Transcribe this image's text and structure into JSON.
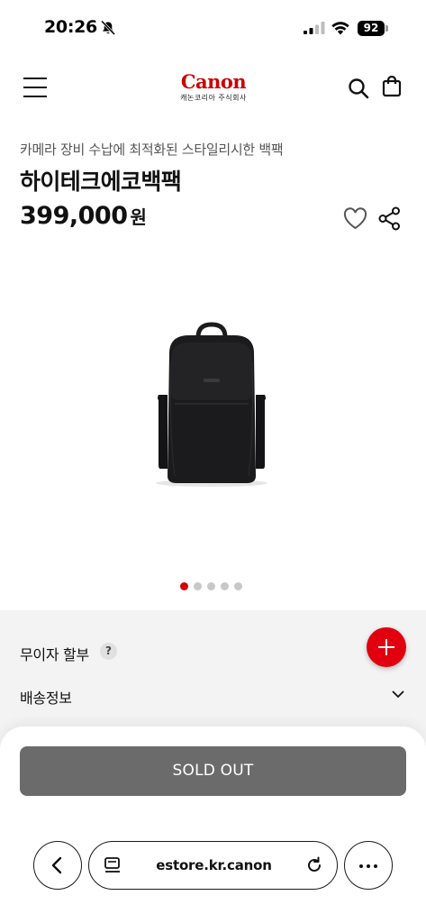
{
  "status_bar": {
    "time": "20:26",
    "battery": "92"
  },
  "header": {
    "logo_text": "Canon",
    "logo_subtext": "캐논코리아 주식회사"
  },
  "product": {
    "subtitle": "카메라 장비 수납에 최적화된 스타일리시한 백팩",
    "title": "하이테크에코백팩",
    "price": "399,000",
    "price_unit": "원",
    "carousel": {
      "total": 5,
      "active_index": 0
    }
  },
  "options": {
    "installment_label": "무이자 할부",
    "help_icon_text": "?",
    "shipping_label": "배송정보"
  },
  "purchase": {
    "sold_out_label": "SOLD OUT"
  },
  "browser": {
    "url": "estore.kr.canon"
  },
  "colors": {
    "brand_red": "#cc0000",
    "accent_red": "#e0000f",
    "sold_out_grey": "#6b6b6b"
  }
}
